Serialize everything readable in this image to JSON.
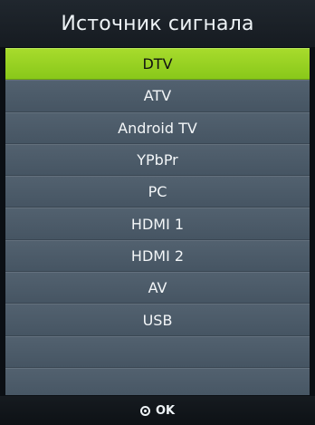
{
  "header": {
    "title": "Источник сигнала"
  },
  "menu": {
    "items": [
      {
        "label": "DTV",
        "selected": true
      },
      {
        "label": "ATV",
        "selected": false
      },
      {
        "label": "Android TV",
        "selected": false
      },
      {
        "label": "YPbPr",
        "selected": false
      },
      {
        "label": "PC",
        "selected": false
      },
      {
        "label": "HDMI 1",
        "selected": false
      },
      {
        "label": "HDMI 2",
        "selected": false
      },
      {
        "label": "AV",
        "selected": false
      },
      {
        "label": "USB",
        "selected": false
      }
    ]
  },
  "footer": {
    "ok_label": "OK",
    "ok_icon": "ok-circle-icon"
  },
  "colors": {
    "selected": "#9ed327",
    "item": "#4b5a68",
    "header": "#1b2128"
  }
}
